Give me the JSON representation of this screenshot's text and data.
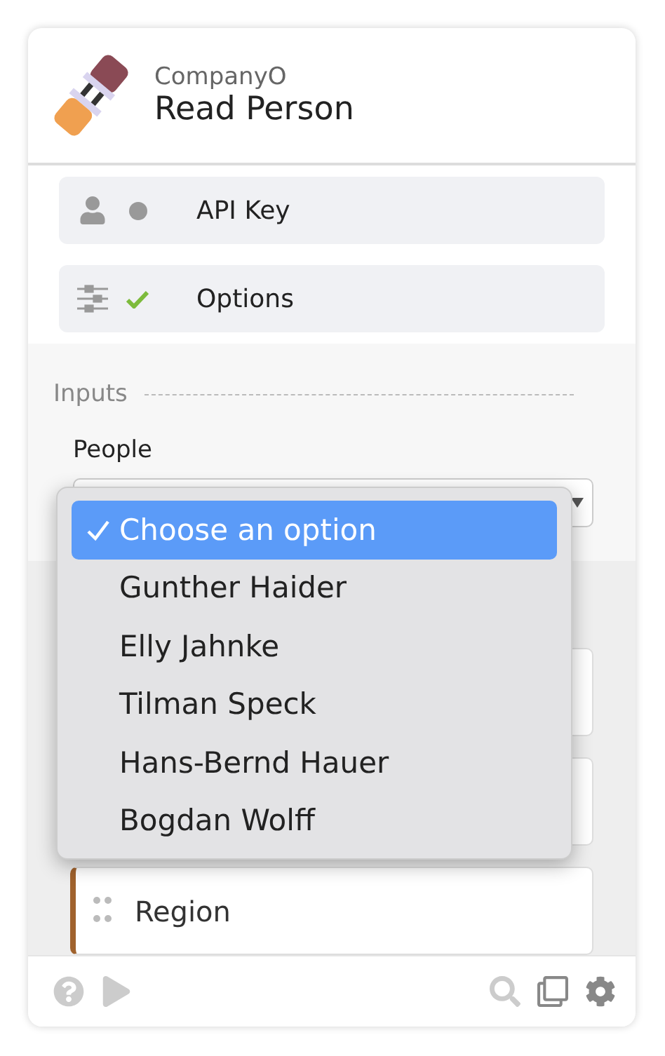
{
  "header": {
    "vendor": "CompanyO",
    "title": "Read Person"
  },
  "sections": [
    {
      "label": "API Key",
      "kind": "account",
      "done": false
    },
    {
      "label": "Options",
      "kind": "options",
      "done": true
    }
  ],
  "inputs": {
    "heading": "Inputs",
    "field_label": "People",
    "options": [
      {
        "label": "Choose an option",
        "selected": true
      },
      {
        "label": "Gunther Haider",
        "selected": false
      },
      {
        "label": "Elly Jahnke",
        "selected": false
      },
      {
        "label": "Tilman Speck",
        "selected": false
      },
      {
        "label": "Hans-Bernd Hauer",
        "selected": false
      },
      {
        "label": "Bogdan Wolff",
        "selected": false
      }
    ]
  },
  "fields": [
    {
      "label": "Region"
    }
  ]
}
